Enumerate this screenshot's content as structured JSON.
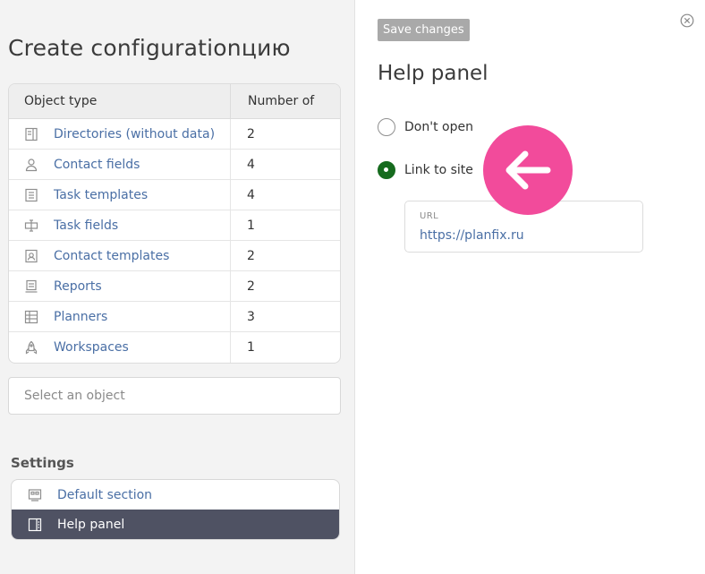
{
  "left": {
    "title": "Create configurationцию",
    "table": {
      "headers": [
        "Object type",
        "Number of"
      ],
      "rows": [
        {
          "icon": "directory-icon",
          "label": "Directories (without data)",
          "count": "2"
        },
        {
          "icon": "contact-icon",
          "label": "Contact fields",
          "count": "4"
        },
        {
          "icon": "task-template-icon",
          "label": "Task templates",
          "count": "4"
        },
        {
          "icon": "task-field-icon",
          "label": "Task fields",
          "count": "1"
        },
        {
          "icon": "contact-template-icon",
          "label": "Contact templates",
          "count": "2"
        },
        {
          "icon": "report-icon",
          "label": "Reports",
          "count": "2"
        },
        {
          "icon": "planner-icon",
          "label": "Planners",
          "count": "3"
        },
        {
          "icon": "workspace-icon",
          "label": "Workspaces",
          "count": "1"
        }
      ]
    },
    "select_placeholder": "Select an object",
    "settings": {
      "title": "Settings",
      "items": [
        {
          "icon": "default-section-icon",
          "label": "Default section",
          "active": false
        },
        {
          "icon": "help-panel-icon",
          "label": "Help panel",
          "active": true
        }
      ]
    }
  },
  "right": {
    "save_label": "Save changes",
    "title": "Help panel",
    "options": [
      {
        "label": "Don't open",
        "checked": false
      },
      {
        "label": "Link to site",
        "checked": true
      }
    ],
    "url": {
      "label": "URL",
      "value": "https://planfix.ru"
    }
  },
  "colors": {
    "link": "#4a6fa5",
    "active_item_bg": "#4f5263",
    "radio_checked": "#166b1e",
    "hint_circle": "#f24b9b",
    "save_button_bg": "#a9a9a9"
  }
}
